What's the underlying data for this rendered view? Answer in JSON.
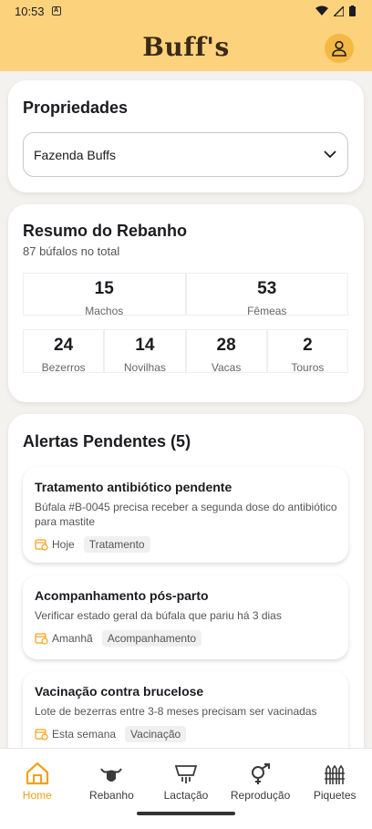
{
  "status_bar": {
    "time": "10:53"
  },
  "header": {
    "logo_text": "Buff's"
  },
  "properties_card": {
    "title": "Propriedades",
    "selected_farm": "Fazenda Buffs"
  },
  "herd_card": {
    "title": "Resumo do Rebanho",
    "subtitle": "87 búfalos no total",
    "primary_stats": [
      {
        "value": "15",
        "label": "Machos"
      },
      {
        "value": "53",
        "label": "Fêmeas"
      }
    ],
    "secondary_stats": [
      {
        "value": "24",
        "label": "Bezerros"
      },
      {
        "value": "14",
        "label": "Novilhas"
      },
      {
        "value": "28",
        "label": "Vacas"
      },
      {
        "value": "2",
        "label": "Touros"
      }
    ]
  },
  "alerts_card": {
    "title": "Alertas Pendentes (5)",
    "alerts": [
      {
        "title": "Tratamento antibiótico pendente",
        "description": "Búfala #B-0045 precisa receber a segunda dose do antibiótico para mastite",
        "when": "Hoje",
        "tag": "Tratamento"
      },
      {
        "title": "Acompanhamento pós-parto",
        "description": "Verificar estado geral da búfala que pariu há 3 dias",
        "when": "Amanhã",
        "tag": "Acompanhamento"
      },
      {
        "title": "Vacinação contra brucelose",
        "description": "Lote de bezerras entre 3-8 meses precisam ser vacinadas",
        "when": "Esta semana",
        "tag": "Vacinação"
      }
    ]
  },
  "bottom_nav": {
    "active": "Home",
    "items": [
      {
        "label": "Home",
        "icon": "home-icon"
      },
      {
        "label": "Rebanho",
        "icon": "buffalo-icon"
      },
      {
        "label": "Lactação",
        "icon": "milking-icon"
      },
      {
        "label": "Reprodução",
        "icon": "gender-icon"
      },
      {
        "label": "Piquetes",
        "icon": "fence-icon"
      }
    ]
  },
  "colors": {
    "header_bg": "#fcd37c",
    "accent": "#f0a21a",
    "profile_bg": "#f4b944",
    "logo": "#3b2a16"
  }
}
